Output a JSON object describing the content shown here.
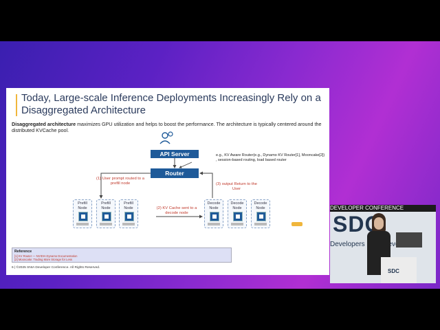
{
  "slide": {
    "title": "Today, Large-scale Inference Deployments Increasingly Rely on a Disaggregated Architecture",
    "desc_bold": "Disaggregated architecture",
    "desc_rest": " maximizes GPU utilization and helps to boost the performance. The architecture is typically centered around the distributed KVCache pool.",
    "api_server": "API Server",
    "router": "Router",
    "router_note": "e.g., KV Aware Router(e.g., Dynamo KV Router[1], Mooncake[2]) , session-based routing, load based router",
    "step1": "(1) User prompt routed to a prefill node",
    "step2": "(2) KV Cache sent to a decode node",
    "step3": "(3) output Return to the User",
    "prefill_nodes": [
      "Prefill Node",
      "Prefill Node",
      "Prefill Node"
    ],
    "decode_nodes": [
      "Decode Node",
      "Decode Node",
      "Decode Node"
    ],
    "reference_header": "Reference",
    "reference_1": "[1] KV Router — NVIDIA Dynamo Documentation",
    "reference_2": "[2] Mooncake: Trading More Storage for Less",
    "copyright": "6 | ©2025 SNIA Developer Conference. All Rights Reserved."
  },
  "overlay": {
    "logo": "SDC",
    "camera_banner": "DEVELOPER CONFERENCE",
    "camera_big": "SDC",
    "camera_sub": "Developers FOR Developers",
    "podium_logo": "SDC"
  }
}
